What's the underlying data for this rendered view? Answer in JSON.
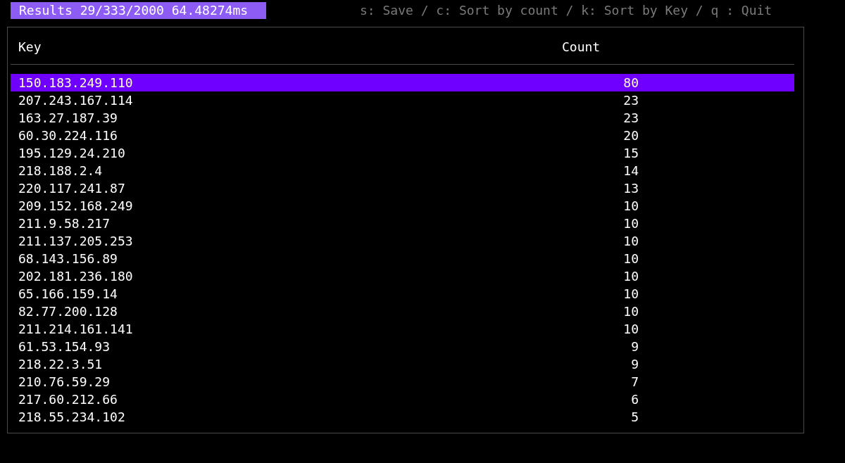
{
  "title": "Results 29/333/2000 64.48274ms",
  "hints": "s: Save / c: Sort by count / k: Sort by Key / q : Quit",
  "table": {
    "columns": [
      "Key",
      "Count"
    ],
    "rows": [
      {
        "key": "150.183.249.110",
        "count": "80",
        "selected": true
      },
      {
        "key": "207.243.167.114",
        "count": "23",
        "selected": false
      },
      {
        "key": "163.27.187.39",
        "count": "23",
        "selected": false
      },
      {
        "key": "60.30.224.116",
        "count": "20",
        "selected": false
      },
      {
        "key": "195.129.24.210",
        "count": "15",
        "selected": false
      },
      {
        "key": "218.188.2.4",
        "count": "14",
        "selected": false
      },
      {
        "key": "220.117.241.87",
        "count": "13",
        "selected": false
      },
      {
        "key": "209.152.168.249",
        "count": "10",
        "selected": false
      },
      {
        "key": "211.9.58.217",
        "count": "10",
        "selected": false
      },
      {
        "key": "211.137.205.253",
        "count": "10",
        "selected": false
      },
      {
        "key": "68.143.156.89",
        "count": "10",
        "selected": false
      },
      {
        "key": "202.181.236.180",
        "count": "10",
        "selected": false
      },
      {
        "key": "65.166.159.14",
        "count": "10",
        "selected": false
      },
      {
        "key": "82.77.200.128",
        "count": "10",
        "selected": false
      },
      {
        "key": "211.214.161.141",
        "count": "10",
        "selected": false
      },
      {
        "key": "61.53.154.93",
        "count": "9",
        "selected": false
      },
      {
        "key": "218.22.3.51",
        "count": "9",
        "selected": false
      },
      {
        "key": "210.76.59.29",
        "count": "7",
        "selected": false
      },
      {
        "key": "217.60.212.66",
        "count": "6",
        "selected": false
      },
      {
        "key": "218.55.234.102",
        "count": "5",
        "selected": false
      }
    ]
  }
}
